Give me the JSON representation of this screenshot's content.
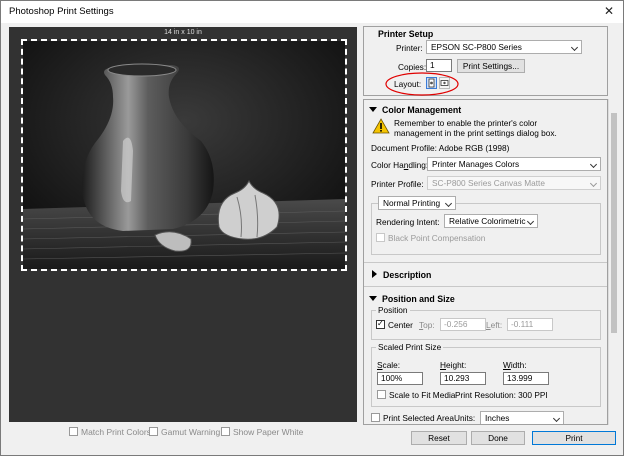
{
  "window": {
    "title": "Photoshop Print Settings",
    "close_glyph": "✕"
  },
  "preview": {
    "doc_size": "14 in x 10 in",
    "match_print_colors": "Match Print Colors",
    "gamut_warning": "Gamut Warning",
    "show_paper_white": "Show Paper White"
  },
  "printer_setup": {
    "title": "Printer Setup",
    "printer_label": "Printer:",
    "printer_value": "EPSON SC-P800 Series",
    "copies_label": "Copies:",
    "copies_value": "1",
    "print_settings_button": "Print Settings...",
    "layout_label": "Layout:"
  },
  "color_management": {
    "title": "Color Management",
    "warning_line1": "Remember to enable the printer's color",
    "warning_line2": "management in the print settings dialog box.",
    "document_profile": "Document Profile: Adobe RGB (1998)",
    "color_handling_label": "Color Handling:",
    "color_handling_value": "Printer Manages Colors",
    "printer_profile_label": "Printer Profile:",
    "printer_profile_value": "SC-P800 Series Canvas Matte",
    "normal_printing": "Normal Printing",
    "rendering_intent_label": "Rendering Intent:",
    "rendering_intent_value": "Relative Colorimetric",
    "black_point": "Black Point Compensation"
  },
  "description": {
    "title": "Description"
  },
  "position_size": {
    "title": "Position and Size",
    "position_group": "Position",
    "center_label": "Center",
    "top_label": "Top:",
    "top_value": "-0.256",
    "left_label": "Left:",
    "left_value": "-0.111",
    "scaled_group": "Scaled Print Size",
    "scale_label": "Scale:",
    "scale_value": "100%",
    "height_label": "Height:",
    "height_value": "10.293",
    "width_label": "Width:",
    "width_value": "13.999",
    "scale_to_fit": "Scale to Fit Media",
    "print_resolution": "Print Resolution: 300 PPI",
    "print_selected_area": "Print Selected Area",
    "units_label": "Units:",
    "units_value": "Inches"
  },
  "footer": {
    "reset": "Reset",
    "done": "Done",
    "print": "Print"
  },
  "colors": {
    "accent": "#0078d7",
    "warning": "#f5c400",
    "highlight_ellipse": "#e00000"
  }
}
